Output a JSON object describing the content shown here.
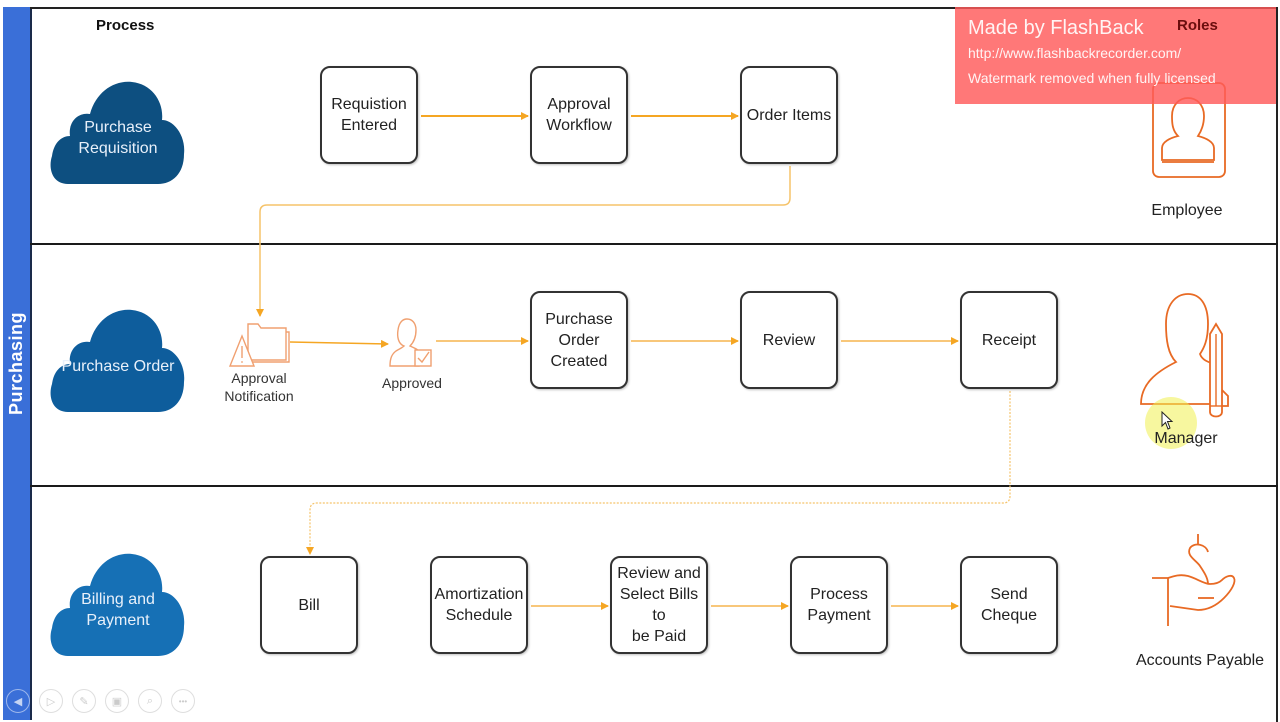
{
  "pool": {
    "label": "Purchasing"
  },
  "headers": {
    "process": "Process",
    "roles": "Roles"
  },
  "colors": {
    "pool_band": "#3a6fd8",
    "cloud_dark": "#0d4f80",
    "cloud_mid": "#0e5d9c",
    "cloud_light": "#1670b5",
    "arrow": "#f5a623",
    "role_icon": "#e86a24"
  },
  "lanes": [
    {
      "cloud": "Purchase\nRequisition",
      "steps": [
        "Requistion\nEntered",
        "Approval\nWorkflow",
        "Order Items"
      ],
      "role": {
        "label": "Employee",
        "icon": "id-badge-person-icon"
      }
    },
    {
      "cloud": "Purchase Order",
      "icon_steps": [
        {
          "label": "Approval\nNotification",
          "icon": "folder-warning-icon"
        },
        {
          "label": "Approved",
          "icon": "person-check-icon"
        }
      ],
      "steps": [
        "Purchase\nOrder Created",
        "Review",
        "Receipt"
      ],
      "role": {
        "label": "Manager",
        "icon": "person-pencil-icon"
      }
    },
    {
      "cloud": "Billing and\nPayment",
      "steps": [
        "Bill",
        "Amortization\nSchedule",
        "Review and\nSelect Bills to\nbe Paid",
        "Process\nPayment",
        "Send Cheque"
      ],
      "role": {
        "label": "Accounts Payable",
        "icon": "hand-dollar-icon"
      }
    }
  ],
  "watermark": {
    "title": "Made by FlashBack",
    "url": "http://www.flashbackrecorder.com/",
    "note": "Watermark removed when fully licensed"
  },
  "player_controls": [
    {
      "name": "previous-button",
      "icon": "◀"
    },
    {
      "name": "play-button",
      "icon": "▷"
    },
    {
      "name": "pen-button",
      "icon": "✎"
    },
    {
      "name": "slides-button",
      "icon": "▣"
    },
    {
      "name": "zoom-button",
      "icon": "⌕"
    },
    {
      "name": "more-button",
      "icon": "•••"
    }
  ]
}
